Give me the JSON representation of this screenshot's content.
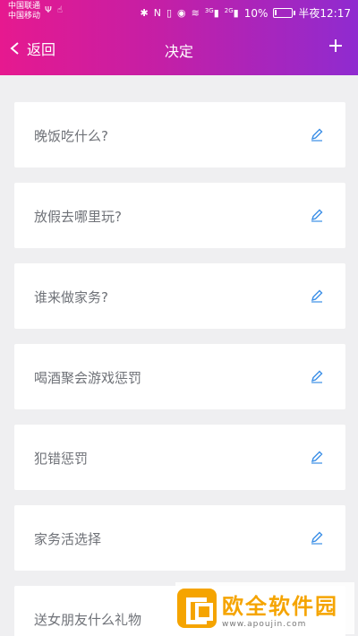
{
  "status_bar": {
    "carrier_1": "中国联通",
    "carrier_2": "中国移动",
    "network_1": "3G",
    "network_2": "2G",
    "battery_percent": "10%",
    "battery_level": 0.1,
    "time": "半夜12:17"
  },
  "nav": {
    "back_label": "返回",
    "title": "决定",
    "add_icon": "plus-icon"
  },
  "decisions": [
    {
      "label": "晚饭吃什么?"
    },
    {
      "label": "放假去哪里玩?"
    },
    {
      "label": "谁来做家务?"
    },
    {
      "label": "喝酒聚会游戏惩罚"
    },
    {
      "label": "犯错惩罚"
    },
    {
      "label": "家务活选择"
    },
    {
      "label": "送女朋友什么礼物"
    }
  ],
  "watermark": {
    "brand": "欧全软件园",
    "url": "www.apoujin.com"
  },
  "colors": {
    "gradient_start": "#e6198f",
    "gradient_end": "#8f2bd0",
    "background": "#efeff1",
    "edit_icon": "#3a8ee6",
    "watermark": "#f5a400"
  }
}
